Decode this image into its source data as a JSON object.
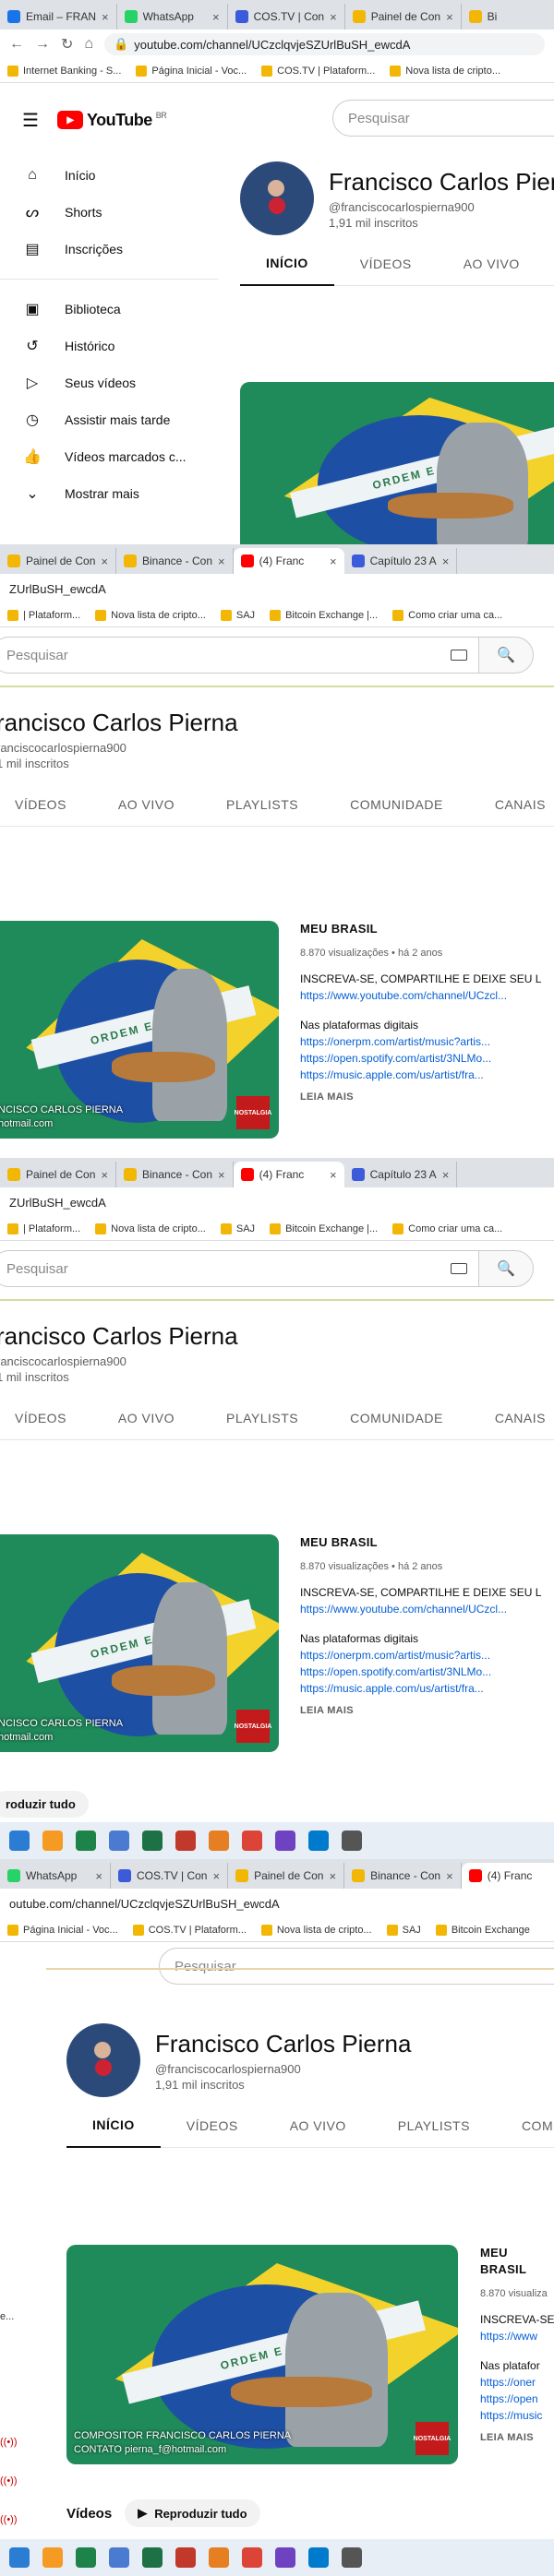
{
  "tabs1": [
    {
      "title": "Email – FRAN",
      "color": "#1a73e8"
    },
    {
      "title": "WhatsApp",
      "color": "#25d366"
    },
    {
      "title": "COS.TV | Con",
      "color": "#3b5bdb"
    },
    {
      "title": "Painel de Con",
      "color": "#f2b705"
    },
    {
      "title": "Bi",
      "color": "#f2b705"
    }
  ],
  "address1": "youtube.com/channel/UCzclqvjeSZUrlBuSH_ewcdA",
  "bookmarks1": [
    "Internet Banking - S...",
    "Página Inicial - Voc...",
    "COS.TV | Plataform...",
    "Nova lista de cripto..."
  ],
  "yt": {
    "logo": "YouTube",
    "region": "BR",
    "search_placeholder": "Pesquisar",
    "sidebar": [
      {
        "label": "Início",
        "icon": "home-icon",
        "glyph": "⌂"
      },
      {
        "label": "Shorts",
        "icon": "shorts-icon",
        "glyph": "ᔕ"
      },
      {
        "label": "Inscrições",
        "icon": "subscriptions-icon",
        "glyph": "▤"
      },
      {
        "label": "Biblioteca",
        "icon": "library-icon",
        "glyph": "▣"
      },
      {
        "label": "Histórico",
        "icon": "history-icon",
        "glyph": "↺"
      },
      {
        "label": "Seus vídeos",
        "icon": "your-videos-icon",
        "glyph": "▷"
      },
      {
        "label": "Assistir mais tarde",
        "icon": "watch-later-icon",
        "glyph": "◷"
      },
      {
        "label": "Vídeos marcados c...",
        "icon": "liked-icon",
        "glyph": "👍"
      },
      {
        "label": "Mostrar mais",
        "icon": "chevron-down-icon",
        "glyph": "⌄"
      }
    ]
  },
  "channel": {
    "name": "Francisco Carlos Pierna",
    "handle": "@franciscocarlospierna900",
    "subs": "1,91 mil inscritos"
  },
  "channel_tabs1": [
    "INÍCIO",
    "VÍDEOS",
    "AO VIVO"
  ],
  "tabs2": [
    {
      "title": "Painel de Con",
      "color": "#f2b705"
    },
    {
      "title": "Binance - Con",
      "color": "#f2b705"
    },
    {
      "title": "(4) Franc",
      "color": "#ff0000"
    },
    {
      "title": "Capítulo 23 A",
      "color": "#3b5bdb"
    }
  ],
  "address2": "ZUrlBuSH_ewcdA",
  "bookmarks2": [
    "| Plataform...",
    "Nova lista de cripto...",
    "SAJ",
    "Bitcoin Exchange |...",
    "Como criar uma ca..."
  ],
  "channel_partial": {
    "name": "rancisco Carlos Pierna",
    "handle": "ranciscocarlospierna900",
    "subs": "1 mil inscritos"
  },
  "channel_tabs2": [
    "VÍDEOS",
    "AO VIVO",
    "PLAYLISTS",
    "COMUNIDADE",
    "CANAIS"
  ],
  "video": {
    "title": "MEU BRASIL",
    "meta": "8.870 visualizações • há 2 anos",
    "desc": "INSCREVA-SE, COMPARTILHE E DEIXE SEU L",
    "link0": "https://www.youtube.com/channel/UCzcl...",
    "platforms": "Nas plataformas digitais",
    "links": [
      "https://onerpm.com/artist/music?artis...",
      "https://open.spotify.com/artist/3NLMo...",
      "https://music.apple.com/us/artist/fra..."
    ],
    "more": "LEIA MAIS",
    "thumb_band": "ORDEM E PROG",
    "thumb_caption1": "COMPOSITOR FRANCISCO CARLOS PIERNA",
    "thumb_caption2": "CONTATO pierna_f@hotmail.com",
    "thumb_caption_partial1": "NCISCO CARLOS PIERNA",
    "thumb_caption_partial2": "hotmail.com",
    "thumb_logo": "NOSTALGIA"
  },
  "play_all": "Reproduzir tudo",
  "play_all_partial": "roduzir tudo",
  "videos_heading": "Vídeos",
  "tabs4": [
    {
      "title": "WhatsApp",
      "color": "#25d366"
    },
    {
      "title": "COS.TV | Con",
      "color": "#3b5bdb"
    },
    {
      "title": "Painel de Con",
      "color": "#f2b705"
    },
    {
      "title": "Binance - Con",
      "color": "#f2b705"
    },
    {
      "title": "(4) Franc",
      "color": "#ff0000"
    }
  ],
  "address4": "outube.com/channel/UCzclqvjeSZUrlBuSH_ewcdA",
  "bookmarks4": [
    "Página Inicial - Voc...",
    "COS.TV | Plataform...",
    "Nova lista de cripto...",
    "SAJ",
    "Bitcoin Exchange"
  ],
  "channel_tabs4": [
    "INÍCIO",
    "VÍDEOS",
    "AO VIVO",
    "PLAYLISTS",
    "COMUNIDADE"
  ],
  "video4": {
    "title": "MEU BRASIL",
    "meta": "8.870 visualiza",
    "desc": "INSCREVA-SE",
    "link0": "https://www",
    "platforms": "Nas platafor",
    "links": [
      "https://oner",
      "https://open",
      "https://music"
    ],
    "more": "LEIA MAIS"
  },
  "side_fragment": "e...",
  "taskbar_colors": [
    "#2b7cd3",
    "#f59a23",
    "#1d8348",
    "#4a7bd0",
    "#1e7145",
    "#c0392b",
    "#e67e22",
    "#db4437",
    "#6f42c1",
    "#007acc",
    "#555"
  ]
}
